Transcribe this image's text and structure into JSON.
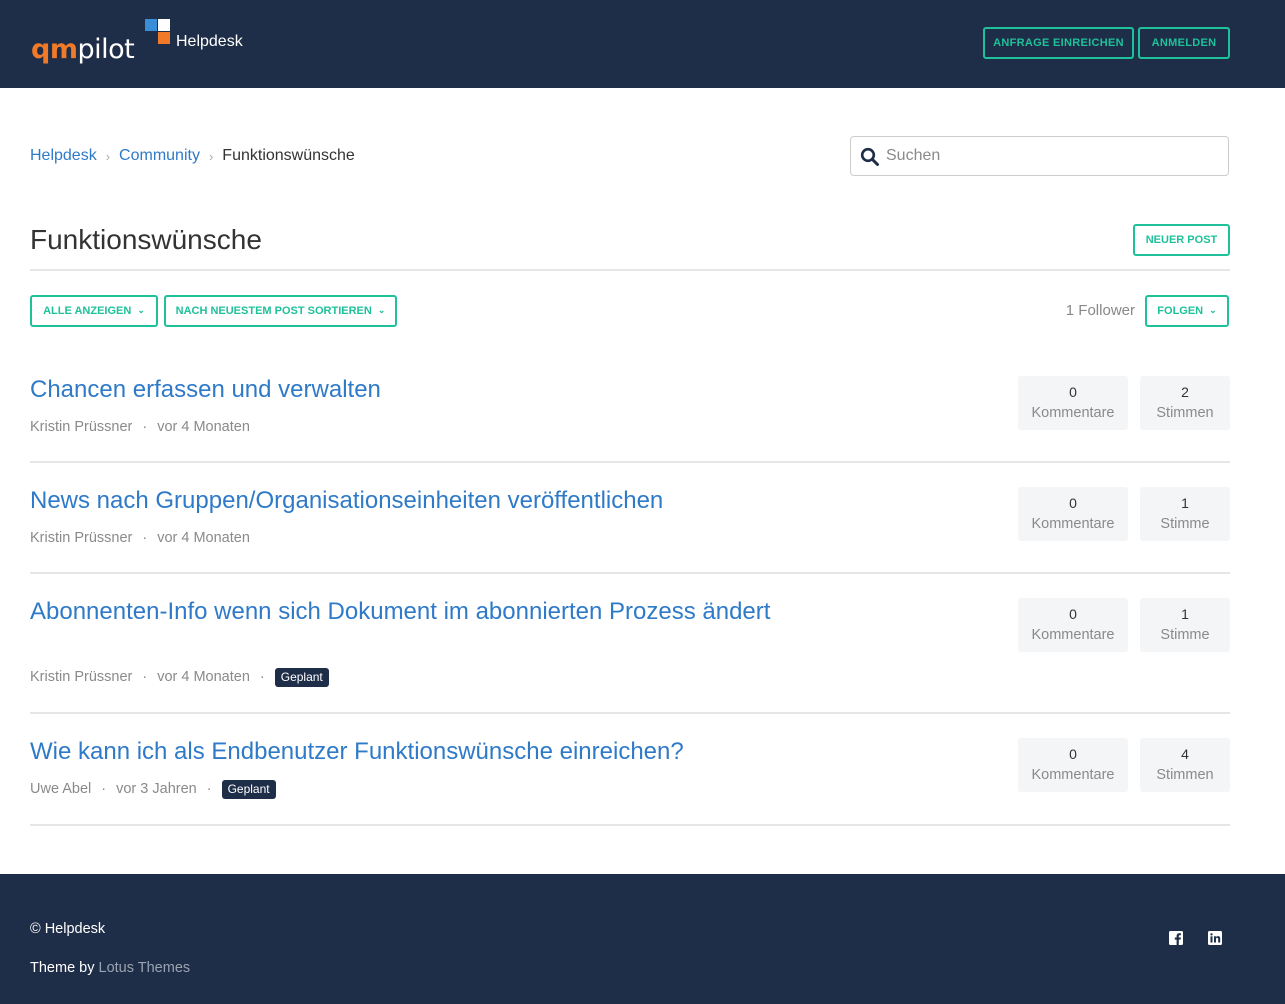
{
  "header": {
    "logo_qm": "qm",
    "logo_pilot": "pilot",
    "logo_suffix": "Helpdesk",
    "request_button": "ANFRAGE EINREICHEN",
    "login_button": "ANMELDEN"
  },
  "breadcrumb": {
    "items": [
      "Helpdesk",
      "Community"
    ],
    "current": "Funktionswünsche",
    "separator": "›"
  },
  "search": {
    "placeholder": "Suchen",
    "value": ""
  },
  "page": {
    "title": "Funktionswünsche",
    "new_post_button": "NEUER POST"
  },
  "filters": {
    "show_all": "ALLE ANZEIGEN",
    "sort": "NACH NEUESTEM POST SORTIEREN",
    "followers": "1 Follower",
    "follow": "FOLGEN"
  },
  "posts": [
    {
      "title": "Chancen erfassen und verwalten",
      "author": "Kristin Prüssner",
      "time": "vor 4 Monaten",
      "badge": "",
      "comments_count": "0",
      "comments_label": "Kommentare",
      "votes_count": "2",
      "votes_label": "Stimmen"
    },
    {
      "title": "News nach Gruppen/Organisationseinheiten veröffentlichen",
      "author": "Kristin Prüssner",
      "time": "vor 4 Monaten",
      "badge": "",
      "comments_count": "0",
      "comments_label": "Kommentare",
      "votes_count": "1",
      "votes_label": "Stimme"
    },
    {
      "title": "Abonnenten-Info wenn sich Dokument im abonnierten Prozess ändert",
      "author": "Kristin Prüssner",
      "time": "vor 4 Monaten",
      "badge": "Geplant",
      "comments_count": "0",
      "comments_label": "Kommentare",
      "votes_count": "1",
      "votes_label": "Stimme"
    },
    {
      "title": "Wie kann ich als Endbenutzer Funktionswünsche einreichen?",
      "author": "Uwe Abel",
      "time": "vor 3 Jahren",
      "badge": "Geplant",
      "comments_count": "0",
      "comments_label": "Kommentare",
      "votes_count": "4",
      "votes_label": "Stimmen"
    }
  ],
  "footer": {
    "copyright": "© Helpdesk",
    "theme_by": "Theme by",
    "theme_name": "Lotus Themes",
    "social_icons": [
      "facebook-icon",
      "linkedin-icon"
    ]
  },
  "colors": {
    "header_bg": "#1f2e48",
    "accent": "#1fc19a",
    "link": "#2f7ac8",
    "logo_orange": "#f07a28",
    "logo_blue": "#3a8ed8",
    "badge_bg": "#1f2e48"
  }
}
